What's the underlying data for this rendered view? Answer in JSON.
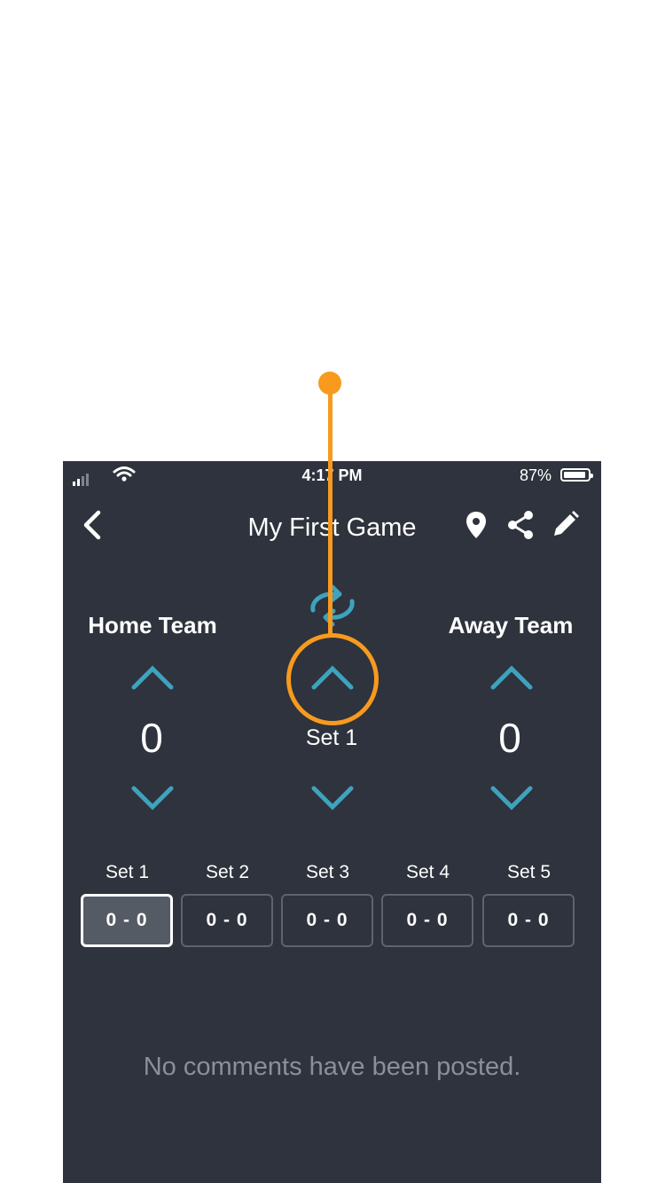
{
  "status_bar": {
    "time": "4:17 PM",
    "battery_percent": "87%"
  },
  "nav": {
    "title": "My First Game"
  },
  "scoreboard": {
    "home_label": "Home Team",
    "away_label": "Away Team",
    "home_score": "0",
    "away_score": "0",
    "current_set": "Set 1"
  },
  "sets": [
    {
      "label": "Set 1",
      "score": "0 - 0",
      "active": true
    },
    {
      "label": "Set 2",
      "score": "0 - 0",
      "active": false
    },
    {
      "label": "Set 3",
      "score": "0 - 0",
      "active": false
    },
    {
      "label": "Set 4",
      "score": "0 - 0",
      "active": false
    },
    {
      "label": "Set 5",
      "score": "0 - 0",
      "active": false
    }
  ],
  "comments": {
    "empty_text": "No comments have been posted."
  },
  "colors": {
    "background": "#2e333d",
    "accent": "#3ea3bd",
    "annotation": "#f79a1e"
  }
}
